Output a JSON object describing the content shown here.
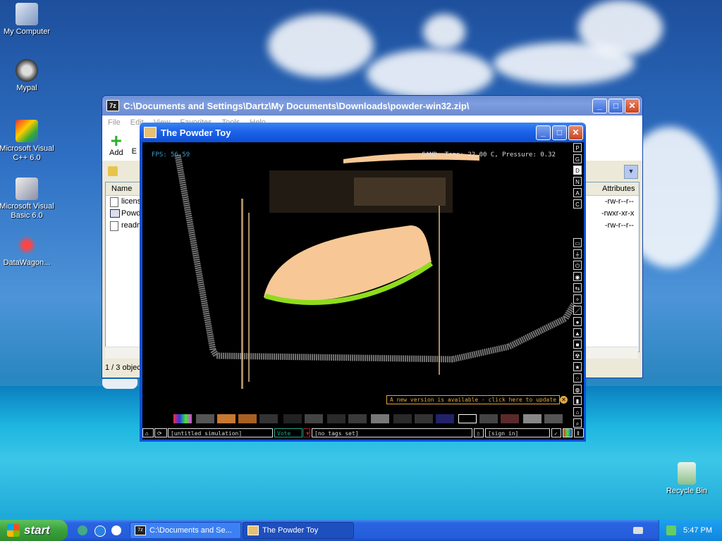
{
  "desktop": {
    "icons": [
      {
        "label": "My Computer",
        "icon": "my-computer-icon"
      },
      {
        "label": "Mypal",
        "icon": "mypal-icon"
      },
      {
        "label": "Microsoft Visual C++ 6.0",
        "icon": "visual-cpp-icon"
      },
      {
        "label": "Microsoft Visual Basic 6.0",
        "icon": "visual-basic-icon"
      },
      {
        "label": "DataWagon...",
        "icon": "datawagon-icon"
      },
      {
        "label": "Recycle Bin",
        "icon": "recycle-bin-icon"
      }
    ]
  },
  "sevenzip": {
    "title": "C:\\Documents and Settings\\Dartz\\My Documents\\Downloads\\powder-win32.zip\\",
    "menu": [
      "File",
      "Edit",
      "View",
      "Favorites",
      "Tools",
      "Help"
    ],
    "toolbar": {
      "add_label": "Add",
      "next_partial": "E"
    },
    "columns": {
      "name": "Name",
      "attributes": "Attributes"
    },
    "rows": [
      {
        "name": "licens",
        "attributes": "-rw-r--r--"
      },
      {
        "name": "Powd",
        "attributes": "-rwxr-xr-x"
      },
      {
        "name": "readm",
        "attributes": "-rw-r--r--"
      }
    ],
    "status": "1 / 3 objec"
  },
  "powdertoy": {
    "title": "The Powder Toy",
    "fps": "FPS: 56.59",
    "info": "SAND, Temp: 22.00 C, Pressure: 0.32",
    "side_top": [
      "P",
      "G",
      "D",
      "N",
      "A",
      "C"
    ],
    "side_top_active": "D",
    "notice": "A new version is available - click here to update",
    "bottom": {
      "sim_name": "[untitled simulation]",
      "vote": "Vote",
      "tags": "[no tags set]",
      "sign_in": "[sign in]"
    },
    "colors": {
      "sand": "#f7c895",
      "plant": "#8fdc1c",
      "wall": "#8a8a8a"
    }
  },
  "taskbar": {
    "start": "start",
    "tasks": [
      {
        "label": "C:\\Documents and Se...",
        "icon": "7z-icon",
        "active": false
      },
      {
        "label": "The Powder Toy",
        "icon": "powder-toy-icon",
        "active": true
      }
    ],
    "clock": "5:47 PM"
  }
}
